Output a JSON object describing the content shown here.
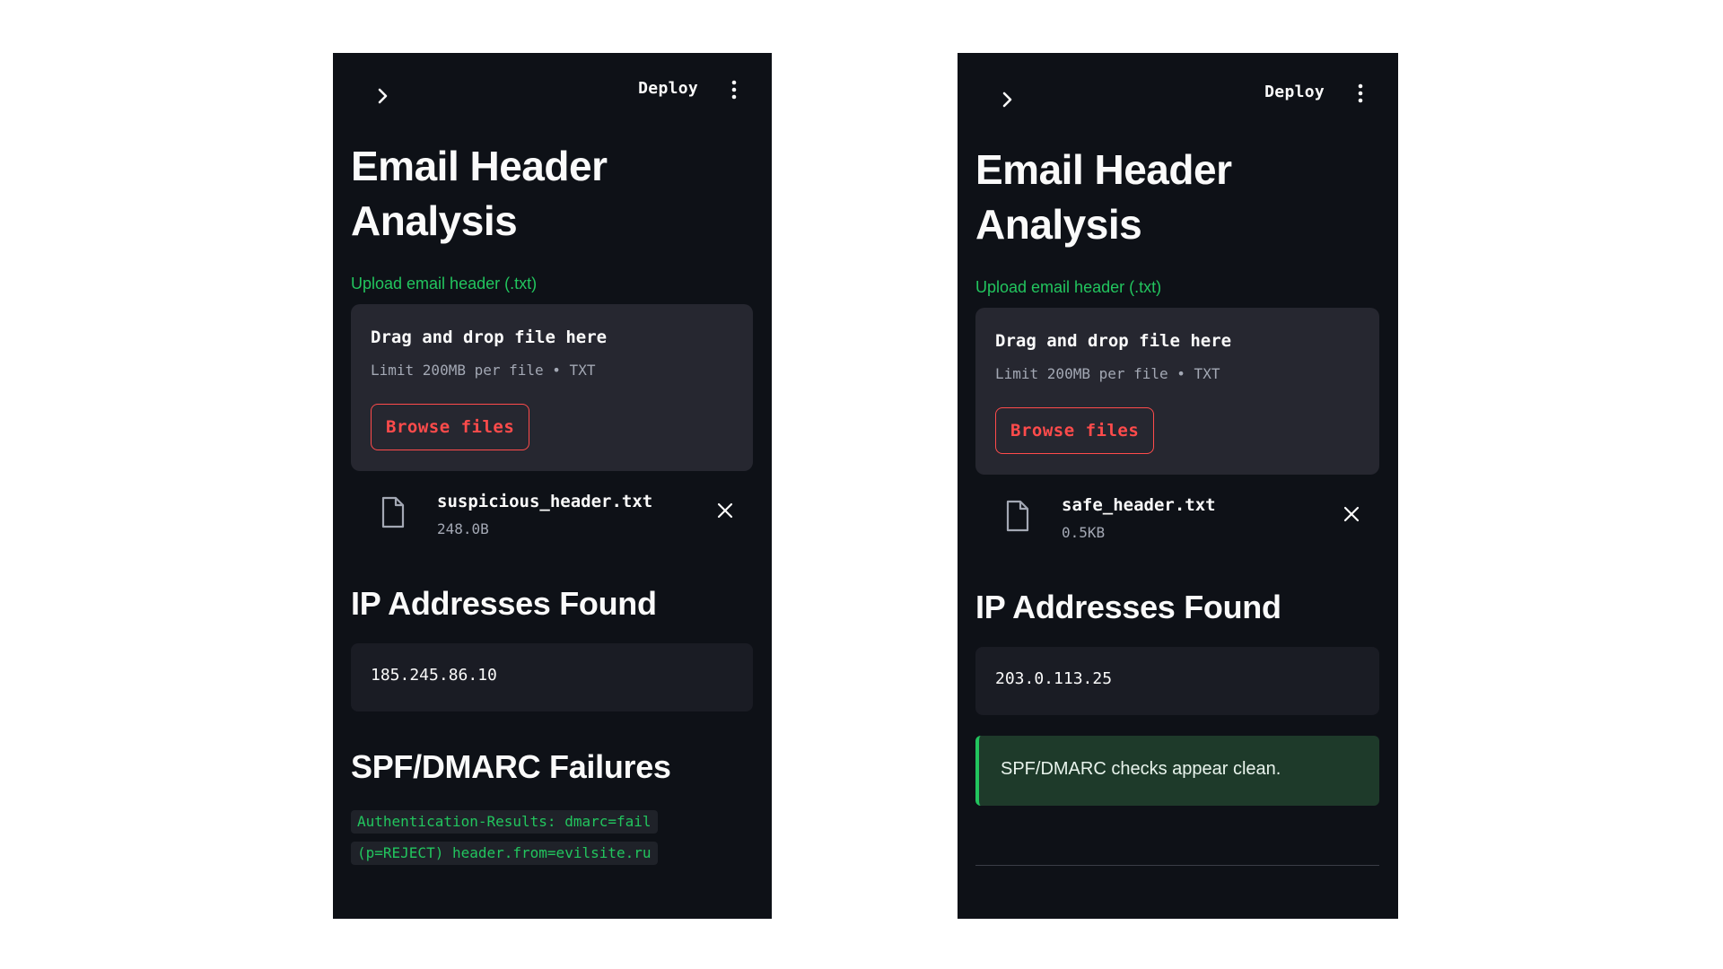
{
  "panels": [
    {
      "topbar": {
        "chevron_icon": "chevron-right-icon",
        "deploy_label": "Deploy",
        "menu_icon": "kebab-menu-icon"
      },
      "title_line1": "Email Header",
      "title_line2": "Analysis",
      "uploader": {
        "label": "Upload email header (.txt)",
        "drop_title": "Drag and drop file here",
        "drop_subtitle": "Limit 200MB per file • TXT",
        "browse_label": "Browse files"
      },
      "uploaded_file": {
        "name": "suspicious_header.txt",
        "size": "248.0B"
      },
      "ip_section": {
        "heading": "IP Addresses Found",
        "ip": "185.245.86.10"
      },
      "spf_section": {
        "heading": "SPF/DMARC Failures",
        "lines": [
          "Authentication-Results: dmarc=fail",
          "(p=REJECT) header.from=evilsite.ru"
        ]
      }
    },
    {
      "topbar": {
        "chevron_icon": "chevron-right-icon",
        "deploy_label": "Deploy",
        "menu_icon": "kebab-menu-icon"
      },
      "title_line1": "Email Header",
      "title_line2": "Analysis",
      "uploader": {
        "label": "Upload email header (.txt)",
        "drop_title": "Drag and drop file here",
        "drop_subtitle": "Limit 200MB per file • TXT",
        "browse_label": "Browse files"
      },
      "uploaded_file": {
        "name": "safe_header.txt",
        "size": "0.5KB"
      },
      "ip_section": {
        "heading": "IP Addresses Found",
        "ip": "203.0.113.25"
      },
      "status": {
        "message": "SPF/DMARC checks appear clean."
      }
    }
  ],
  "colors": {
    "panel_bg": "#0e1117",
    "accent_green": "#22c55e",
    "accent_red": "#ff4b4b",
    "dropzone_bg": "#262730",
    "success_bg": "#1e3a2a"
  }
}
